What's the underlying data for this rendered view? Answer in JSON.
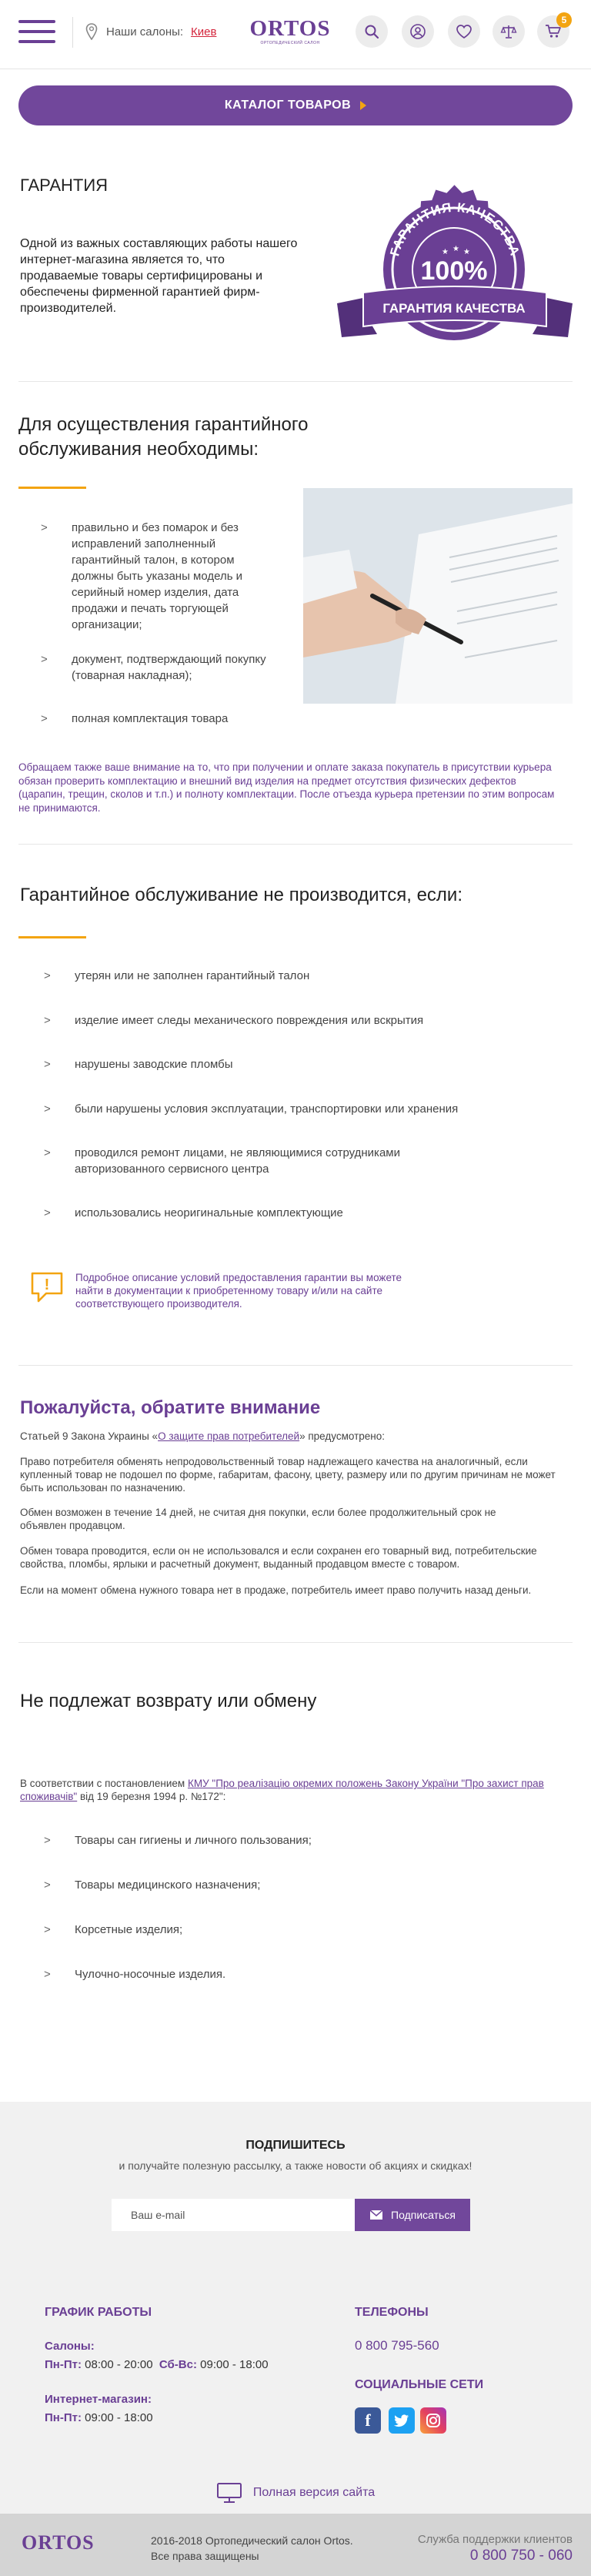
{
  "header": {
    "salons_label": "Наши салоны:",
    "salons_city": "Киев",
    "logo_text": "ORTOS",
    "logo_sub": "ОРТОПЕДИЧЕСКИЙ САЛОН",
    "cart_count": "5"
  },
  "catalog_button": "КАТАЛОГ ТОВАРОВ",
  "guarantee": {
    "title": "ГАРАНТИЯ",
    "text": "Одной из важных составляющих работы нашего интернет-магазина является то, что продаваемые товары сертифицированы и обеспечены фирменной гарантией фирм-производителей.",
    "seal_top": "ГАРАНТИЯ КАЧЕСТВА",
    "seal_center": "100%",
    "seal_ribbon": "ГАРАНТИЯ КАЧЕСТВА"
  },
  "service": {
    "title": "Для осуществления гарантийного обслуживания необходимы:",
    "items": [
      "правильно и без помарок и  без исправлений заполненный гарантийный талон, в котором должны быть указаны модель и серийный номер изделия, дата продажи и печать торгующей организации;",
      "документ, подтверждающий покупку (товарная накладная);",
      "полная комплектация товара"
    ],
    "notice": "Обращаем также ваше внимание на то, что при получении и оплате заказа покупатель в присутствии курьера обязан проверить комплектацию и внешний вид изделия на предмет отсутствия физических дефектов (царапин, трещин, сколов и т.п.) и полноту комплектации. После отъезда курьера претензии по этим вопросам не принимаются."
  },
  "not_performed": {
    "title": "Гарантийное обслуживание не производится, если:",
    "items": [
      "утерян или не заполнен гарантийный талон",
      "изделие имеет следы механического повреждения или вскрытия",
      "нарушены заводские пломбы",
      "были нарушены условия эксплуатации, транспортировки или хранения",
      "проводился ремонт лицами, не являющимися сотрудниками авторизованного сервисного центра",
      "использовались неоригинальные комплектующие"
    ],
    "note": "Подробное описание условий предоставления гарантии вы можете найти в документации к приобретенному товару и/или на сайте соответствующего производителя."
  },
  "attention": {
    "title": "Пожалуйста, обратите внимание",
    "law_prefix": " Статьей 9 Закона Украины «",
    "law_link": "О защите прав потребителей",
    "law_suffix": "» предусмотрено:",
    "p1": "Право потребителя обменять непродовольственный товар надлежащего качества на аналогичный, если купленный товар не подошел по форме, габаритам, фасону, цвету, размеру или по другим причинам не может быть использован по назначению.",
    "p2": "Обмен возможен в течение 14 дней, не считая дня покупки, если более продолжительный срок не объявлен продавцом.",
    "p3": "Обмен товара проводится, если он не использовался и если сохранен его товарный вид, потребительские свойства, пломбы, ярлыки и расчетный документ, выданный продавцом вместе с товаром.",
    "p4": "Если на момент обмена нужного товара нет в продаже, потребитель имеет право получить назад деньги."
  },
  "no_return": {
    "title": "Не подлежат возврату или обмену",
    "intro_prefix": "В соответствии с постановлением ",
    "intro_link": "КМУ \"Про реалізацію окремих положень Закону України \"Про захист прав споживачів\"",
    "intro_suffix": " від 19 березня 1994 р. №172\":",
    "items": [
      "Товары сан гигиены и личного пользования;",
      "Товары медицинского назначения;",
      "Корсетные изделия;",
      "Чулочно-носочные изделия."
    ]
  },
  "subscribe": {
    "title": "ПОДПИШИТЕСЬ",
    "desc": "и получайте полезную рассылку, а также новости об акциях и скидках!",
    "placeholder": "Ваш e-mail",
    "button": "Подписаться"
  },
  "footer": {
    "schedule_title": "ГРАФИК РАБОТЫ",
    "salons_label": "Салоны:",
    "weekdays_label": "Пн-Пт:",
    "weekdays_hours": "08:00 - 20:00",
    "weekend_label": "Сб-Вс:",
    "weekend_hours": "09:00 - 18:00",
    "shop_label": "Интернет-магазин:",
    "shop_days": "Пн-Пт:",
    "shop_hours": "09:00 - 18:00",
    "phones_title": "ТЕЛЕФОНЫ",
    "phone": "0 800 795-560",
    "social_title": "СОЦИАЛЬНЫЕ СЕТИ",
    "full_version": "Полная версия сайта",
    "logo": "ORTOS",
    "copyright_line1": "2016-2018  Ортопедический салон Ortos.",
    "copyright_line2": "Все права защищены",
    "support_label": "Служба поддержки клиентов",
    "support_phone": "0 800 750 - 060"
  },
  "colors": {
    "brand": "#71479b",
    "accent": "#f3a411",
    "city": "#d4243b"
  }
}
